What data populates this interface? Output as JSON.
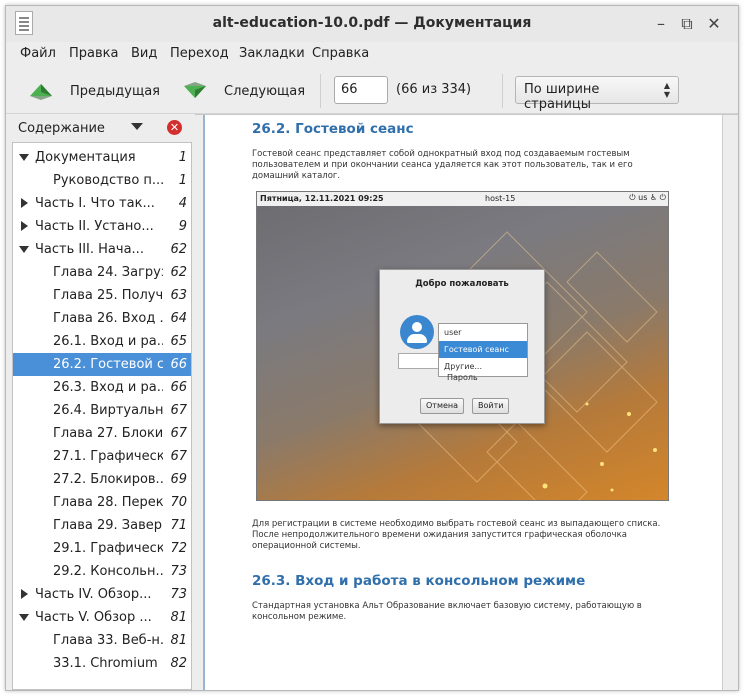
{
  "window": {
    "title": "alt-education-10.0.pdf — Документация",
    "controls": {
      "minimize": "–",
      "maximize": "⧉",
      "close": "✕"
    }
  },
  "menu": [
    "Файл",
    "Правка",
    "Вид",
    "Переход",
    "Закладки",
    "Справка"
  ],
  "toolbar": {
    "prev_label": "Предыдущая",
    "next_label": "Следующая",
    "page_value": "66",
    "page_count": "(66 из 334)",
    "zoom_value": "По ширине страницы"
  },
  "sidebar": {
    "title": "Содержание",
    "close_glyph": "✕",
    "items": [
      {
        "label": "Документация",
        "page": "1",
        "level": 0,
        "arrow": "down"
      },
      {
        "label": "Руководство п...",
        "page": "1",
        "level": 1,
        "arrow": ""
      },
      {
        "label": "Часть I. Что так...",
        "page": "4",
        "level": 0,
        "arrow": "right"
      },
      {
        "label": "Часть II. Устано...",
        "page": "9",
        "level": 0,
        "arrow": "right"
      },
      {
        "label": "Часть III. Нача...",
        "page": "62",
        "level": 0,
        "arrow": "down"
      },
      {
        "label": "Глава 24. Загруз...",
        "page": "62",
        "level": 1,
        "arrow": ""
      },
      {
        "label": "Глава 25. Получ...",
        "page": "63",
        "level": 1,
        "arrow": ""
      },
      {
        "label": "Глава 26. Вход ...",
        "page": "64",
        "level": 1,
        "arrow": ""
      },
      {
        "label": "26.1. Вход и ра...",
        "page": "65",
        "level": 1,
        "arrow": ""
      },
      {
        "label": "26.2. Гостевой с...",
        "page": "66",
        "level": 1,
        "arrow": "",
        "selected": true
      },
      {
        "label": "26.3. Вход и ра...",
        "page": "66",
        "level": 1,
        "arrow": ""
      },
      {
        "label": "26.4. Виртуальн...",
        "page": "67",
        "level": 1,
        "arrow": ""
      },
      {
        "label": "Глава 27. Блоки...",
        "page": "67",
        "level": 1,
        "arrow": ""
      },
      {
        "label": "27.1. Графическ...",
        "page": "67",
        "level": 1,
        "arrow": ""
      },
      {
        "label": "27.2. Блокиров...",
        "page": "69",
        "level": 1,
        "arrow": ""
      },
      {
        "label": "Глава 28. Перек...",
        "page": "70",
        "level": 1,
        "arrow": ""
      },
      {
        "label": "Глава 29. Завер...",
        "page": "71",
        "level": 1,
        "arrow": ""
      },
      {
        "label": "29.1. Графическ...",
        "page": "72",
        "level": 1,
        "arrow": ""
      },
      {
        "label": "29.2. Консольн...",
        "page": "73",
        "level": 1,
        "arrow": ""
      },
      {
        "label": "Часть IV. Обзор...",
        "page": "73",
        "level": 0,
        "arrow": "right"
      },
      {
        "label": "Часть V. Обзор ...",
        "page": "81",
        "level": 0,
        "arrow": "down"
      },
      {
        "label": "Глава 33. Веб-н...",
        "page": "81",
        "level": 1,
        "arrow": ""
      },
      {
        "label": "33.1. Chromium",
        "page": "82",
        "level": 1,
        "arrow": ""
      }
    ]
  },
  "document": {
    "heading1": "26.2. Гостевой сеанс",
    "para1": "Гостевой сеанс представляет собой однократный вход под создаваемым гостевым пользователем и при окончании сеанса удаляется как этот пользователь, так и его домашний каталог.",
    "screenshot": {
      "date": "Пятница, 12.11.2021 09:25",
      "host": "host-15",
      "tray": "⏻ us ♿ ⏻",
      "welcome": "Добро пожаловать",
      "options": [
        "user",
        "Гостевой сеанс",
        "Другие..."
      ],
      "password_label": "Пароль",
      "cancel": "Отмена",
      "login": "Войти"
    },
    "para2": "Для регистрации в системе необходимо выбрать гостевой сеанс из выпадающего списка. После непродолжительного времени ожидания запустится графическая оболочка операционной системы.",
    "heading2": "26.3. Вход и работа в консольном режиме",
    "para3": "Стандартная установка Альт Образование включает базовую систему, работающую в консольном режиме."
  },
  "colors": {
    "accent": "#4a90d9",
    "heading": "#2f6fab",
    "close": "#d32f2f"
  }
}
